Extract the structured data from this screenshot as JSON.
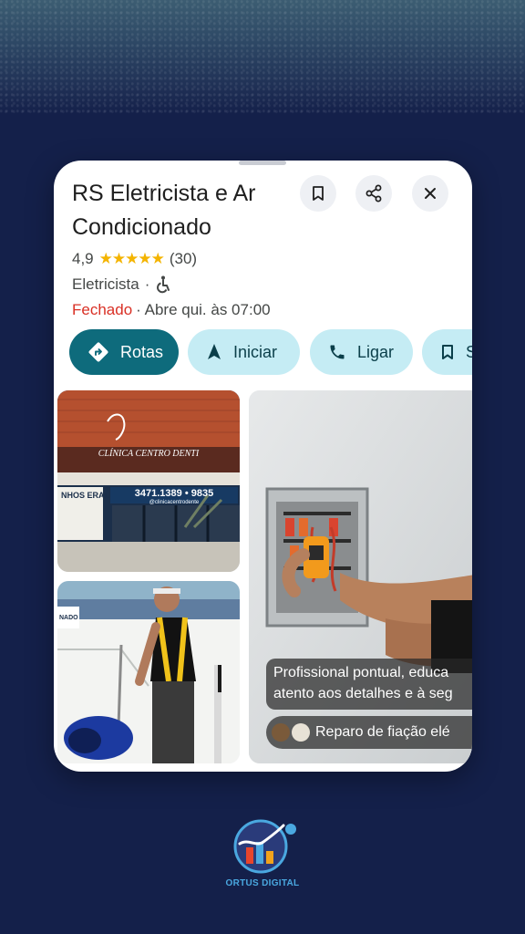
{
  "place": {
    "name": "RS Eletricista e Ar Condicionado",
    "rating": "4,9",
    "stars": "★★★★★",
    "review_count": "(30)",
    "category": "Eletricista",
    "category_separator": "·",
    "status": "Fechado",
    "hours_text": "· Abre qui. às 07:00"
  },
  "header_buttons": {
    "save_icon": "bookmark-icon",
    "share_icon": "share-icon",
    "close_icon": "close-icon"
  },
  "actions": [
    {
      "label": "Rotas",
      "icon": "directions-icon"
    },
    {
      "label": "Iniciar",
      "icon": "navigation-arrow-icon"
    },
    {
      "label": "Ligar",
      "icon": "phone-icon"
    },
    {
      "label": "S",
      "icon": "bookmark-icon"
    }
  ],
  "photos": {
    "storefront_sign": "CLÍNICA CENTRO DENTI",
    "storefront_phone": "3471.1389 • 9835",
    "storefront_handle": "@clinicacentrodente",
    "storefront_side": "NHOS ERAL",
    "worker_side_tag": "NADO"
  },
  "review": {
    "snippet_line1": "Profissional pontual, educa",
    "snippet_line2": "atento aos detalhes e à seg",
    "chip_label": "Reparo de fiação elé"
  },
  "brand": {
    "logo_text": "ORTUS DIGITAL"
  },
  "colors": {
    "background": "#14204a",
    "primary_action": "#0e6b7c",
    "secondary_action": "#c5ecf4",
    "closed_status": "#d93025",
    "stars": "#f4b400"
  }
}
